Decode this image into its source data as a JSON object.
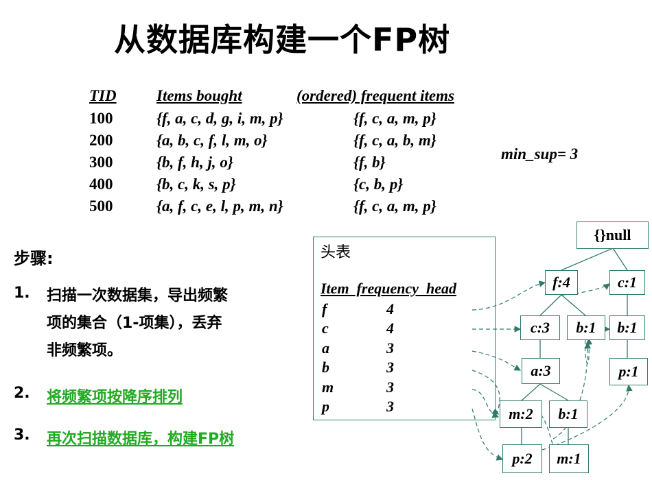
{
  "title": "从数据库构建一个FP树",
  "transactions": {
    "headers": {
      "tid": "TID",
      "items": "Items bought",
      "freq": "(ordered) frequent items"
    },
    "rows": [
      {
        "tid": "100",
        "items": "{f, a, c, d, g, i, m, p}",
        "freq": "{f, c, a, m, p}"
      },
      {
        "tid": "200",
        "items": "{a, b, c, f, l, m, o}",
        "freq": "{f, c, a, b, m}"
      },
      {
        "tid": "300",
        "items": "{b, f, h, j, o}",
        "freq": "{f, b}"
      },
      {
        "tid": "400",
        "items": "{b, c, k, s, p}",
        "freq": "{c, b, p}"
      },
      {
        "tid": "500",
        "items": "{a, f, c, e, l, p, m, n}",
        "freq": "{f, c, a, m, p}"
      }
    ]
  },
  "min_sup": "min_sup= 3",
  "steps": {
    "title": "步骤:",
    "items": [
      {
        "num": "1.",
        "lines": [
          "扫描一次数据集，导出频繁",
          "项的集合（1-项集），丢弃",
          "非频繁项。"
        ]
      },
      {
        "num": "2.",
        "lines": [
          "将频繁项按降序排列"
        ]
      },
      {
        "num": "3.",
        "lines": [
          "再次扫描数据库，构建FP树"
        ]
      }
    ]
  },
  "header_table": {
    "title": "头表",
    "columns": "Item  frequency  head",
    "rows": [
      {
        "item": "f",
        "freq": "4"
      },
      {
        "item": "c",
        "freq": "4"
      },
      {
        "item": "a",
        "freq": "3"
      },
      {
        "item": "b",
        "freq": "3"
      },
      {
        "item": "m",
        "freq": "3"
      },
      {
        "item": "p",
        "freq": "3"
      }
    ]
  },
  "tree": {
    "root": "{}null",
    "nodes": {
      "f4": "f:4",
      "c1a": "c:1",
      "c3": "c:3",
      "b1a": "b:1",
      "b1b": "b:1",
      "a3": "a:3",
      "p1a": "p:1",
      "m2": "m:2",
      "b1c": "b:1",
      "p2": "p:2",
      "m1": "m:1"
    }
  },
  "colors": {
    "border": "#2f7a6a",
    "accent_green": "#22aa22"
  }
}
